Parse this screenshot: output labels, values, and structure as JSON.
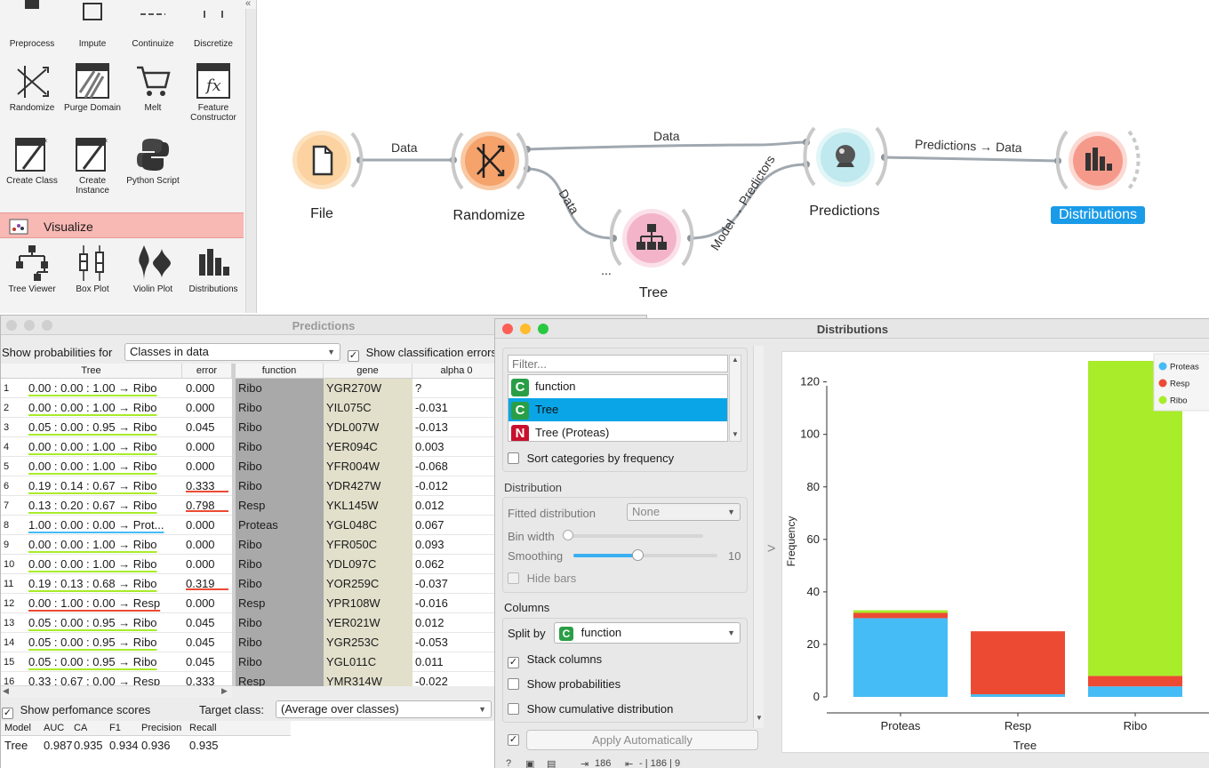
{
  "toolbox": {
    "top_row": [
      "Preprocess",
      "Impute",
      "Continuize",
      "Discretize"
    ],
    "row2": [
      "Randomize",
      "Purge Domain",
      "Melt",
      "Feature Constructor"
    ],
    "row3": [
      "Create Class",
      "Create Instance",
      "Python Script"
    ],
    "visualize_label": "Visualize",
    "row4": [
      "Tree Viewer",
      "Box Plot",
      "Violin Plot",
      "Distributions"
    ],
    "collapse_glyph": "«"
  },
  "canvas": {
    "nodes": {
      "file": "File",
      "randomize": "Randomize",
      "tree": "Tree",
      "predictions": "Predictions",
      "distributions": "Distributions"
    },
    "links": {
      "file_randomize": "Data",
      "randomize_predictions": "Data",
      "randomize_tree": "Data",
      "tree_predictions": "Model → Predictors",
      "predictions_distributions": "Predictions → Data"
    },
    "ellipsis": "..."
  },
  "predictions": {
    "title": "Predictions",
    "show_prob_label": "Show probabilities for",
    "show_prob_value": "Classes in data",
    "show_errors_label": "Show classification errors",
    "columns": [
      "Tree",
      "error",
      "function",
      "gene",
      "alpha 0"
    ],
    "rows": [
      {
        "n": "1",
        "tree": "0.00 : 0.00 : 1.00 → Ribo",
        "error": "0.000",
        "function": "Ribo",
        "gene": "YGR270W",
        "alpha": "?"
      },
      {
        "n": "2",
        "tree": "0.00 : 0.00 : 1.00 → Ribo",
        "error": "0.000",
        "function": "Ribo",
        "gene": "YIL075C",
        "alpha": "-0.031"
      },
      {
        "n": "3",
        "tree": "0.05 : 0.00 : 0.95 → Ribo",
        "error": "0.045",
        "function": "Ribo",
        "gene": "YDL007W",
        "alpha": "-0.013"
      },
      {
        "n": "4",
        "tree": "0.00 : 0.00 : 1.00 → Ribo",
        "error": "0.000",
        "function": "Ribo",
        "gene": "YER094C",
        "alpha": "0.003"
      },
      {
        "n": "5",
        "tree": "0.00 : 0.00 : 1.00 → Ribo",
        "error": "0.000",
        "function": "Ribo",
        "gene": "YFR004W",
        "alpha": "-0.068"
      },
      {
        "n": "6",
        "tree": "0.19 : 0.14 : 0.67 → Ribo",
        "error": "0.333",
        "function": "Ribo",
        "gene": "YDR427W",
        "alpha": "-0.012"
      },
      {
        "n": "7",
        "tree": "0.13 : 0.20 : 0.67 → Ribo",
        "error": "0.798",
        "function": "Resp",
        "gene": "YKL145W",
        "alpha": "0.012"
      },
      {
        "n": "8",
        "tree": "1.00 : 0.00 : 0.00 → Prot...",
        "error": "0.000",
        "function": "Proteas",
        "gene": "YGL048C",
        "alpha": "0.067"
      },
      {
        "n": "9",
        "tree": "0.00 : 0.00 : 1.00 → Ribo",
        "error": "0.000",
        "function": "Ribo",
        "gene": "YFR050C",
        "alpha": "0.093"
      },
      {
        "n": "10",
        "tree": "0.00 : 0.00 : 1.00 → Ribo",
        "error": "0.000",
        "function": "Ribo",
        "gene": "YDL097C",
        "alpha": "0.062"
      },
      {
        "n": "11",
        "tree": "0.19 : 0.13 : 0.68 → Ribo",
        "error": "0.319",
        "function": "Ribo",
        "gene": "YOR259C",
        "alpha": "-0.037"
      },
      {
        "n": "12",
        "tree": "0.00 : 1.00 : 0.00 → Resp",
        "error": "0.000",
        "function": "Resp",
        "gene": "YPR108W",
        "alpha": "-0.016"
      },
      {
        "n": "13",
        "tree": "0.05 : 0.00 : 0.95 → Ribo",
        "error": "0.045",
        "function": "Ribo",
        "gene": "YER021W",
        "alpha": "0.012"
      },
      {
        "n": "14",
        "tree": "0.05 : 0.00 : 0.95 → Ribo",
        "error": "0.045",
        "function": "Ribo",
        "gene": "YGR253C",
        "alpha": "-0.053"
      },
      {
        "n": "15",
        "tree": "0.05 : 0.00 : 0.95 → Ribo",
        "error": "0.045",
        "function": "Ribo",
        "gene": "YGL011C",
        "alpha": "0.011"
      },
      {
        "n": "16",
        "tree": "0.33 : 0.67 : 0.00 → Resp",
        "error": "0.333",
        "function": "Resp",
        "gene": "YMR314W",
        "alpha": "-0.022"
      }
    ],
    "show_perf_label": "Show perfomance scores",
    "target_class_label": "Target class:",
    "target_class_value": "(Average over classes)",
    "scores_headers": [
      "Model",
      "AUC",
      "CA",
      "F1",
      "Precision",
      "Recall"
    ],
    "scores_row": [
      "Tree",
      "0.987",
      "0.935",
      "0.934",
      "0.936",
      "0.935"
    ]
  },
  "distributions": {
    "title": "Distributions",
    "filter_placeholder": "Filter...",
    "variables": [
      {
        "badge": "C",
        "name": "function",
        "badge_color": "#2a9e46"
      },
      {
        "badge": "C",
        "name": "Tree",
        "badge_color": "#2a9e46"
      },
      {
        "badge": "N",
        "name": "Tree (Proteas)",
        "badge_color": "#c8102e"
      }
    ],
    "sort_label": "Sort categories by frequency",
    "distribution_title": "Distribution",
    "fitted_label": "Fitted distribution",
    "fitted_value": "None",
    "bin_width_label": "Bin width",
    "smoothing_label": "Smoothing",
    "smoothing_value": "10",
    "hide_bars_label": "Hide bars",
    "columns_title": "Columns",
    "split_by_label": "Split by",
    "split_by_value": "function",
    "stack_label": "Stack columns",
    "show_prob_label": "Show probabilities",
    "show_cum_label": "Show cumulative distribution",
    "apply_label": "Apply Automatically",
    "status_in": "186",
    "status_out": "- | 186 | 9",
    "collapse_arrow": ">"
  },
  "chart_data": {
    "type": "bar",
    "stacked": true,
    "categories": [
      "Proteas",
      "Resp",
      "Ribo"
    ],
    "series": [
      {
        "name": "Proteas",
        "color": "#45bcf5",
        "values": [
          30,
          1,
          4
        ]
      },
      {
        "name": "Resp",
        "color": "#ec4a33",
        "values": [
          2,
          24,
          4
        ]
      },
      {
        "name": "Ribo",
        "color": "#a8ec2a",
        "values": [
          1,
          0,
          120
        ]
      }
    ],
    "xlabel": "Tree",
    "ylabel": "Frequency",
    "yticks": [
      0,
      20,
      40,
      60,
      80,
      100,
      120
    ],
    "ylim": [
      0,
      128
    ],
    "legend_position": "top-right",
    "grid": false
  }
}
